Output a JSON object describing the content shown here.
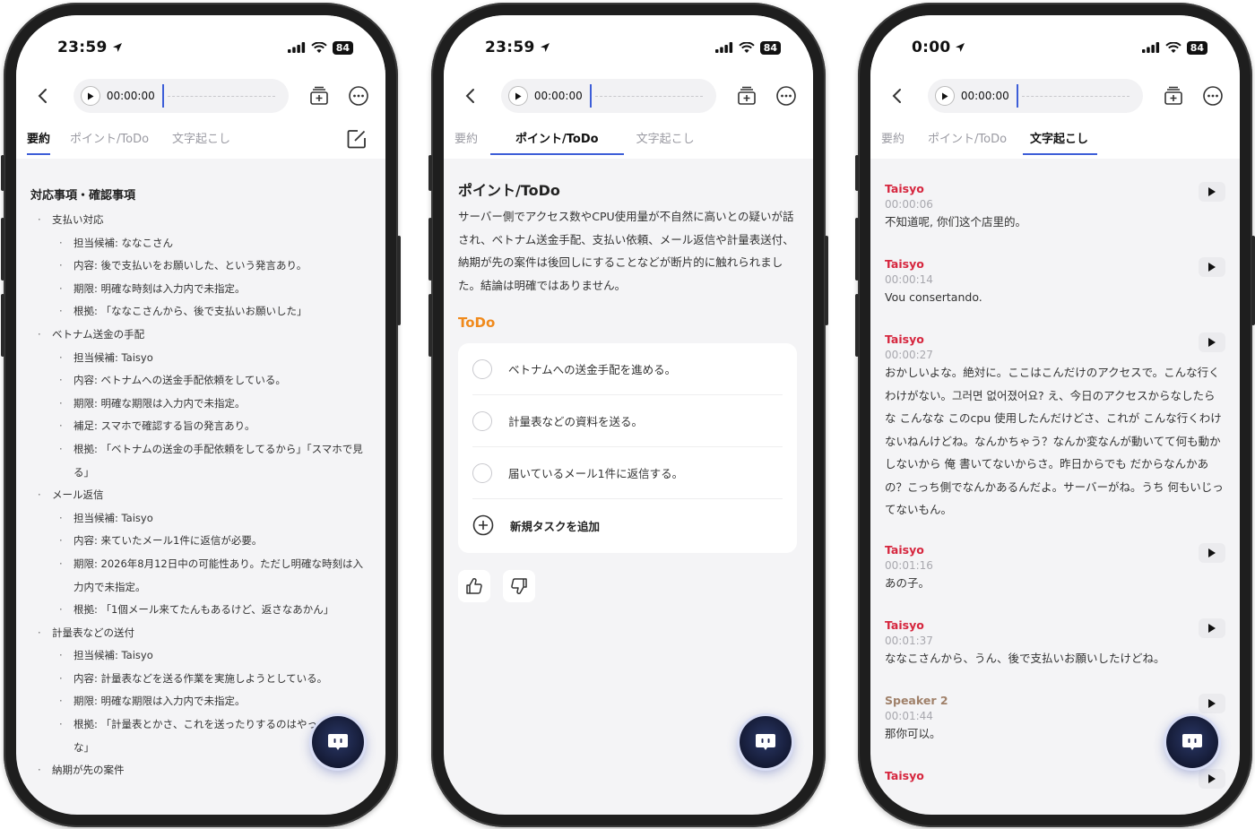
{
  "status": [
    {
      "time": "23:59",
      "battery": "84"
    },
    {
      "time": "23:59",
      "battery": "84"
    },
    {
      "time": "0:00",
      "battery": "84"
    }
  ],
  "player": {
    "time": "00:00:00"
  },
  "tabs": [
    "要約",
    "ポイント/ToDo",
    "文字起こし"
  ],
  "summary": {
    "title": "対応事項・確認事項",
    "groups": [
      {
        "label": "支払い対応",
        "items": [
          "担当候補: ななこさん",
          "内容: 後で支払いをお願いした、という発言あり。",
          "期限: 明確な時刻は入力内で未指定。",
          "根拠: 「ななこさんから、後で支払いお願いした」"
        ]
      },
      {
        "label": "ベトナム送金の手配",
        "items": [
          "担当候補: Taisyo",
          "内容: ベトナムへの送金手配依頼をしている。",
          "期限: 明確な期限は入力内で未指定。",
          "補足: スマホで確認する旨の発言あり。",
          "根拠: 「ベトナムの送金の手配依頼をしてるから」「スマホで見る」"
        ]
      },
      {
        "label": "メール返信",
        "items": [
          "担当候補: Taisyo",
          "内容: 来ていたメール1件に返信が必要。",
          "期限: 2026年8月12日中の可能性あり。ただし明確な時刻は入力内で未指定。",
          "根拠: 「1個メール来てたんもあるけど、返さなあかん」"
        ]
      },
      {
        "label": "計量表などの送付",
        "items": [
          "担当候補: Taisyo",
          "内容: 計量表などを送る作業を実施しようとしている。",
          "期限: 明確な期限は入力内で未指定。",
          "根拠: 「計量表とかさ、これを送ったりするのはやっ　　　かな」"
        ]
      },
      {
        "label": "納期が先の案件",
        "items": []
      }
    ]
  },
  "points": {
    "title": "ポイント/ToDo",
    "body": "サーバー側でアクセス数やCPU使用量が不自然に高いとの疑いが話され、ベトナム送金手配、支払い依頼、メール返信や計量表送付、納期が先の案件は後回しにすることなどが断片的に触れられました。結論は明確ではありません。",
    "todo_heading": "ToDo",
    "todos": [
      "ベトナムへの送金手配を進める。",
      "計量表などの資料を送る。",
      "届いているメール1件に返信する。"
    ],
    "add_task": "新規タスクを追加"
  },
  "transcript": [
    {
      "speaker": "Taisyo",
      "time": "00:00:06",
      "text": "不知道呢, 你们这个店里的。"
    },
    {
      "speaker": "Taisyo",
      "time": "00:00:14",
      "text": "Vou consertando."
    },
    {
      "speaker": "Taisyo",
      "time": "00:00:27",
      "text": "おかしいよな。絶対に。ここはこんだけのアクセスで。こんな行くわけがない。그러면 없어졌어요? え、今日のアクセスからなしたらな こんなな このcpu 使用したんだけどさ、これが こんな行くわけないねんけどね。なんかちゃう？なんか変なんが動いてて何も動かしないから 俺 書いてないからさ。昨日からでも だからなんかあの？こっち側でなんかあるんだよ。サーバーがね。うち 何もいじってないもん。"
    },
    {
      "speaker": "Taisyo",
      "time": "00:01:16",
      "text": "あの子。"
    },
    {
      "speaker": "Taisyo",
      "time": "00:01:37",
      "text": "ななこさんから、うん、後で支払いお願いしたけどね。"
    },
    {
      "speaker": "Speaker 2",
      "time": "00:01:44",
      "text": "那你可以。"
    },
    {
      "speaker": "Taisyo",
      "time": "",
      "text": ""
    }
  ],
  "colors": {
    "accent": "#3d5ed8",
    "todo": "#f08a1c",
    "speaker1": "#d6263e",
    "speaker2": "#a0816a"
  }
}
